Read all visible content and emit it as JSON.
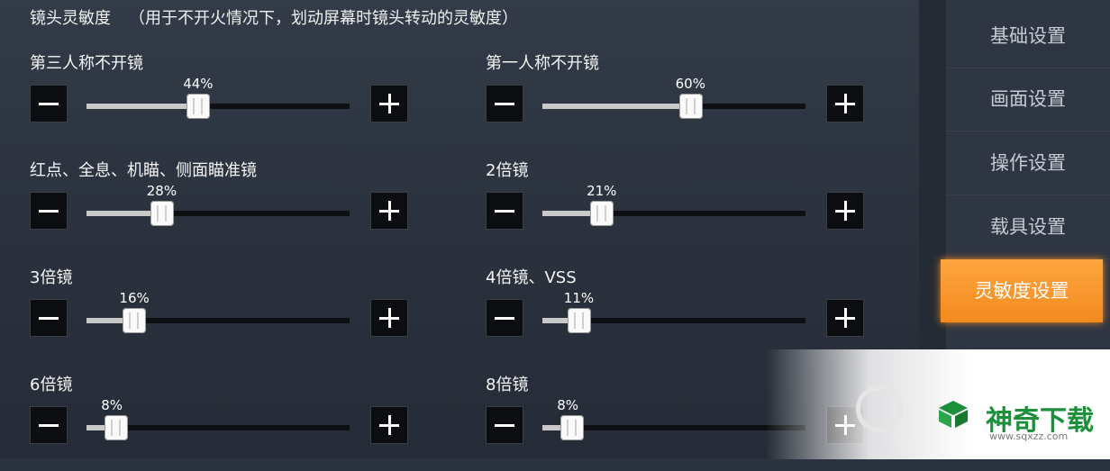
{
  "header": {
    "title": "镜头灵敏度",
    "hint": "（用于不开火情况下，划动屏幕时镜头转动的灵敏度）"
  },
  "sliders": [
    {
      "label": "第三人称不开镜",
      "value": 44,
      "value_text": "44%"
    },
    {
      "label": "第一人称不开镜",
      "value": 60,
      "value_text": "60%"
    },
    {
      "label": "红点、全息、机瞄、侧面瞄准镜",
      "value": 28,
      "value_text": "28%"
    },
    {
      "label": "2倍镜",
      "value": 21,
      "value_text": "21%"
    },
    {
      "label": "3倍镜",
      "value": 16,
      "value_text": "16%"
    },
    {
      "label": "4倍镜、VSS",
      "value": 11,
      "value_text": "11%"
    },
    {
      "label": "6倍镜",
      "value": 8,
      "value_text": "8%"
    },
    {
      "label": "8倍镜",
      "value": 8,
      "value_text": "8%"
    }
  ],
  "sidebar": {
    "items": [
      {
        "label": "基础设置",
        "active": false
      },
      {
        "label": "画面设置",
        "active": false
      },
      {
        "label": "操作设置",
        "active": false
      },
      {
        "label": "载具设置",
        "active": false
      },
      {
        "label": "灵敏度设置",
        "active": true
      }
    ]
  },
  "watermark": {
    "brand": "神奇下载",
    "url": "www.sqxzz.com"
  },
  "colors": {
    "accent": "#f28a1e",
    "watermark_green": "#1c8f3a"
  }
}
